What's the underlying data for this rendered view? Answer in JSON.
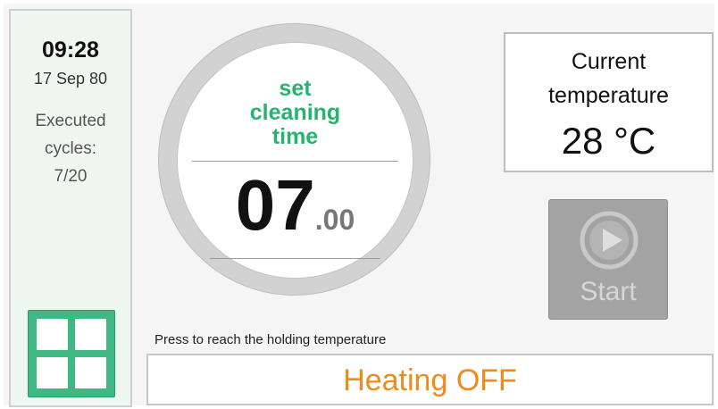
{
  "sidebar": {
    "time": "09:28",
    "date": "17 Sep 80",
    "executed_line1": "Executed",
    "executed_line2": "cycles:",
    "executed_value": "7/20",
    "menu_icon": "grid-menu-icon"
  },
  "dial": {
    "label_line1": "set",
    "label_line2": "cleaning",
    "label_line3": "time",
    "value_whole": "07",
    "value_dot": ".",
    "value_fraction": "00"
  },
  "temperature": {
    "title_line1": "Current",
    "title_line2": "temperature",
    "value": "28 °C"
  },
  "start": {
    "label": "Start",
    "icon": "play-circle-icon",
    "disabled": true
  },
  "heating": {
    "hint": "Press to reach the holding temperature",
    "status": "Heating OFF"
  },
  "colors": {
    "accent_green": "#27b36e",
    "menu_green": "#3fb884",
    "heating_orange": "#f08a1d",
    "disabled_gray": "#a3a3a3"
  }
}
